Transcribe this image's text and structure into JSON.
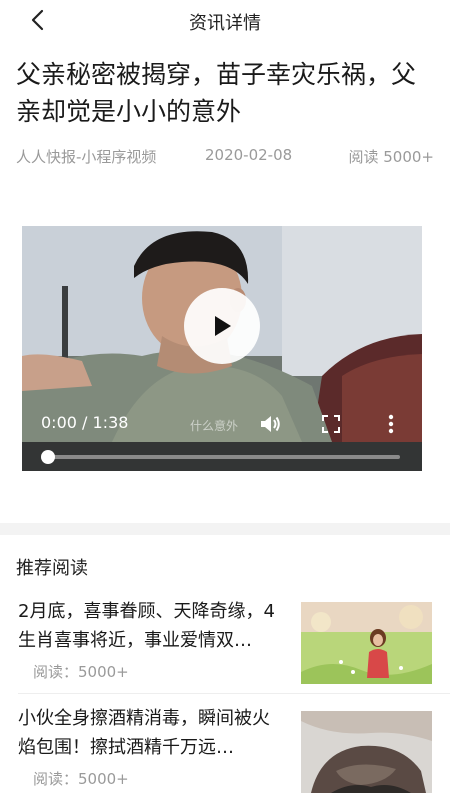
{
  "nav": {
    "title": "资讯详情",
    "back_icon": "chevron-left-icon"
  },
  "article": {
    "headline": "父亲秘密被揭穿，苗子幸灾乐祸，父亲却觉是小小的意外",
    "source": "人人快报-小程序视频",
    "date": "2020-02-08",
    "reads": "阅读 5000+"
  },
  "video": {
    "current_time": "0:00",
    "duration": "1:38",
    "time_text": "0:00 / 1:38",
    "watermark": "什么意外",
    "progress": 0,
    "icons": [
      "play-icon",
      "volume-icon",
      "fullscreen-icon",
      "more-vertical-icon"
    ]
  },
  "recommend": {
    "title": "推荐阅读",
    "items": [
      {
        "text": "2月底，喜事眷顾、天降奇缘，4生肖喜事将近，事业爱情双…",
        "reads": "阅读：5000+"
      },
      {
        "text": "小伙全身擦酒精消毒，瞬间被火焰包围！擦拭酒精千万远…",
        "reads": "阅读：5000+"
      }
    ]
  },
  "colors": {
    "meta_text": "#9a9a9a",
    "divider": "#f3f3f3",
    "player_bar": "#333535"
  }
}
